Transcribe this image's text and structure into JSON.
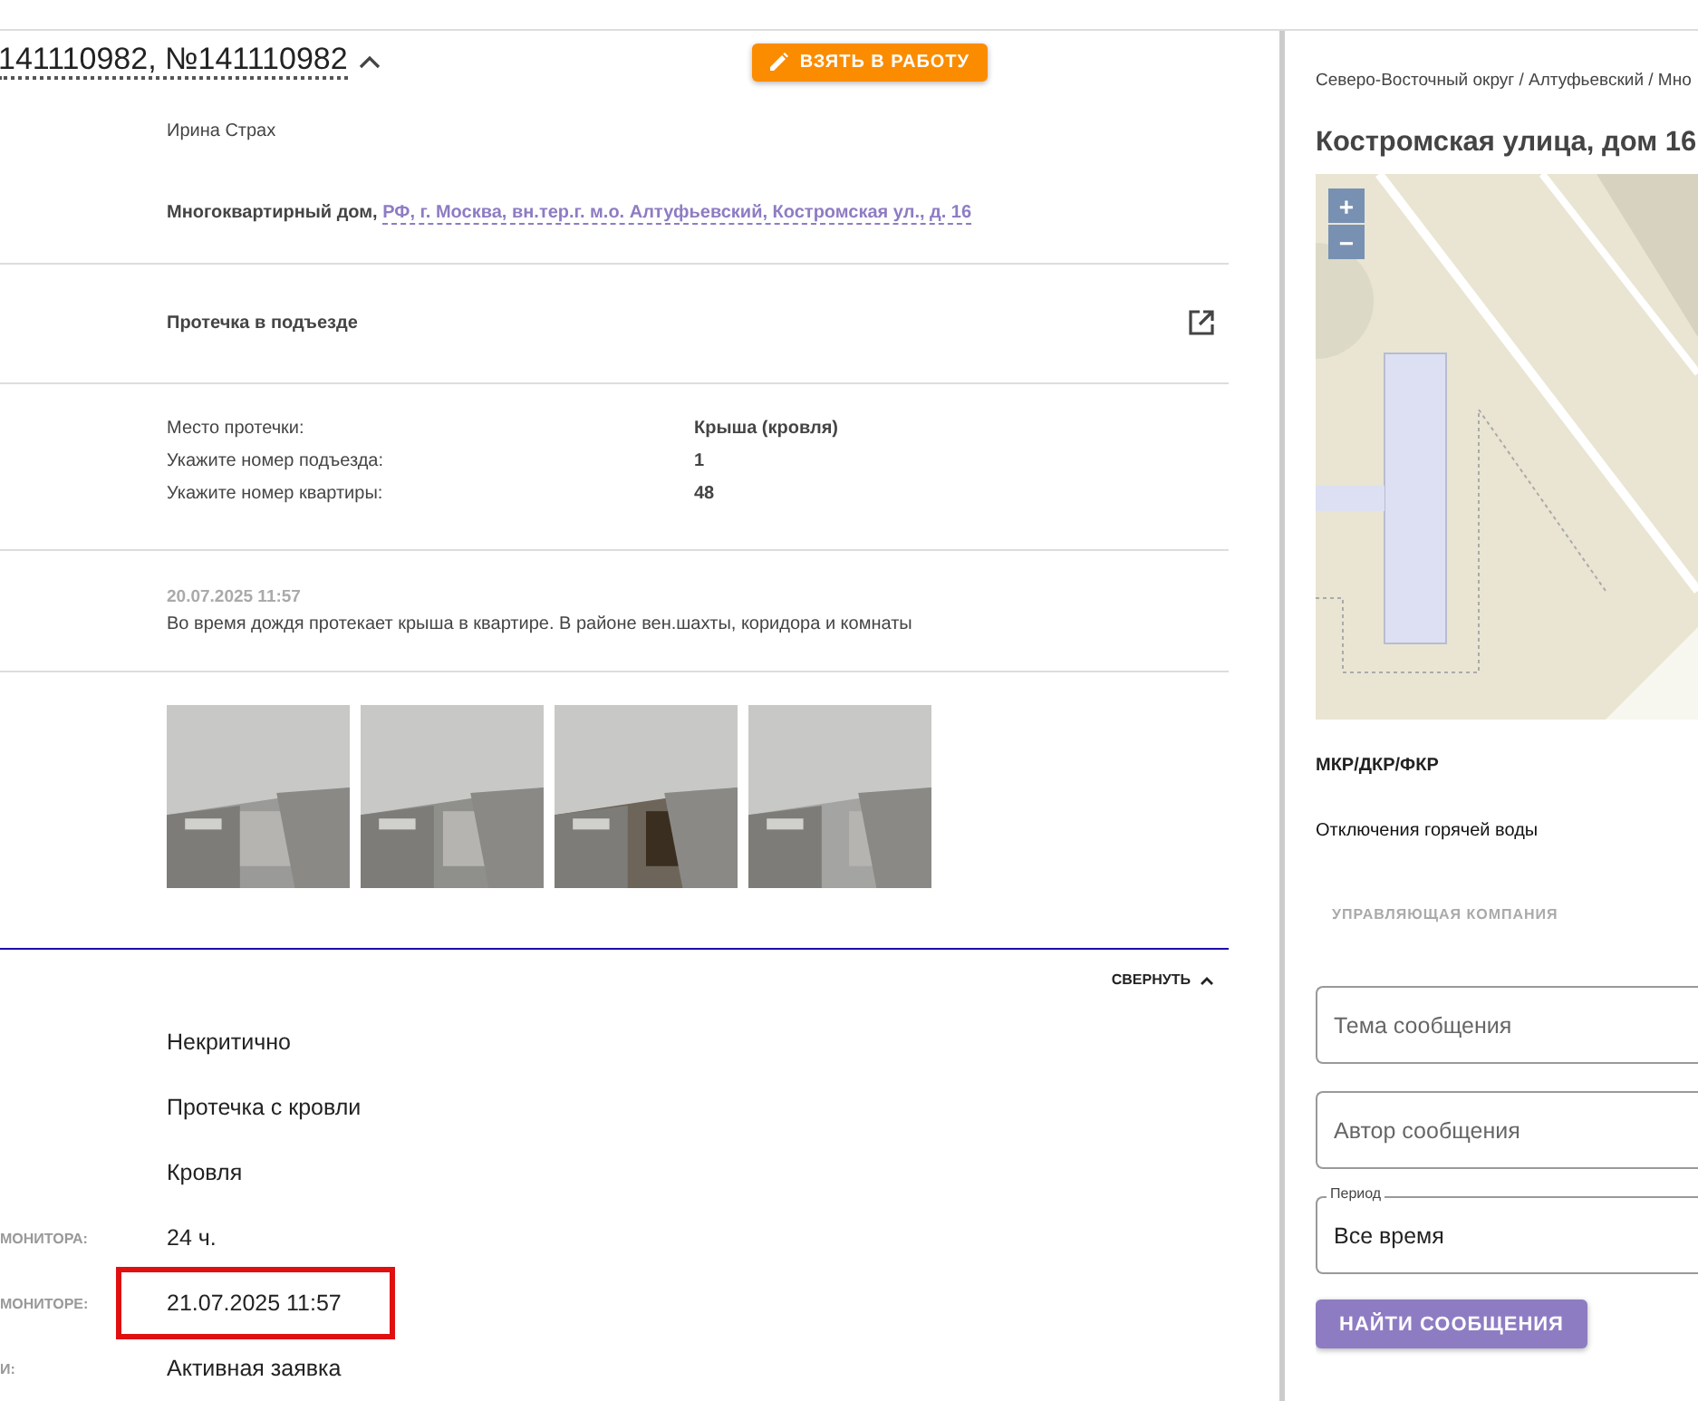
{
  "ticket": {
    "title": "141110982, №141110982",
    "take_button": "ВЗЯТЬ В РАБОТУ",
    "author": "Ирина Страх",
    "building_type": "Многоквартирный дом,",
    "address": "РФ, г. Москва, вн.тер.г. м.о. Алтуфьевский, Костромская ул., д. 16",
    "subject": "Протечка в подъезде",
    "fields": [
      {
        "label": "Место протечки:",
        "value": "Крыша (кровля)"
      },
      {
        "label": "Укажите номер подъезда:",
        "value": "1"
      },
      {
        "label": "Укажите номер квартиры:",
        "value": "48"
      }
    ],
    "comment": {
      "date": "20.07.2025 11:57",
      "text": "Во время дождя протекает крыша в квартире. В районе вен.шахты, коридора и комнаты"
    },
    "collapse_button": "СВЕРНУТЬ",
    "details": [
      {
        "value": "Некритично",
        "highlighted": false
      },
      {
        "value": "Протечка с кровли",
        "highlighted": false
      },
      {
        "value": "Кровля",
        "highlighted": false
      },
      {
        "label": "МОНИТОРА:",
        "value": "24 ч.",
        "highlighted": false
      },
      {
        "label": "МОНИТОРЕ:",
        "value": "21.07.2025 11:57",
        "highlighted": true
      },
      {
        "label": "И:",
        "value": "Активная заявка",
        "highlighted": false
      }
    ]
  },
  "side": {
    "breadcrumb": "Северо-Восточный округ / Алтуфьевский / Мно",
    "title": "Костромская улица, дом 16",
    "map": {
      "zoom_in": "+",
      "zoom_out": "−"
    },
    "program": "МКР/ДКР/ФКР",
    "hot_water": "Отключения горячей воды",
    "company_label": "УПРАВЛЯЮЩАЯ КОМПАНИЯ",
    "fields": [
      {
        "placeholder": "Тема сообщения"
      },
      {
        "placeholder": "Автор сообщения"
      },
      {
        "label": "Период",
        "value": "Все время"
      }
    ],
    "search_button": "НАЙТИ СООБЩЕНИЯ"
  }
}
